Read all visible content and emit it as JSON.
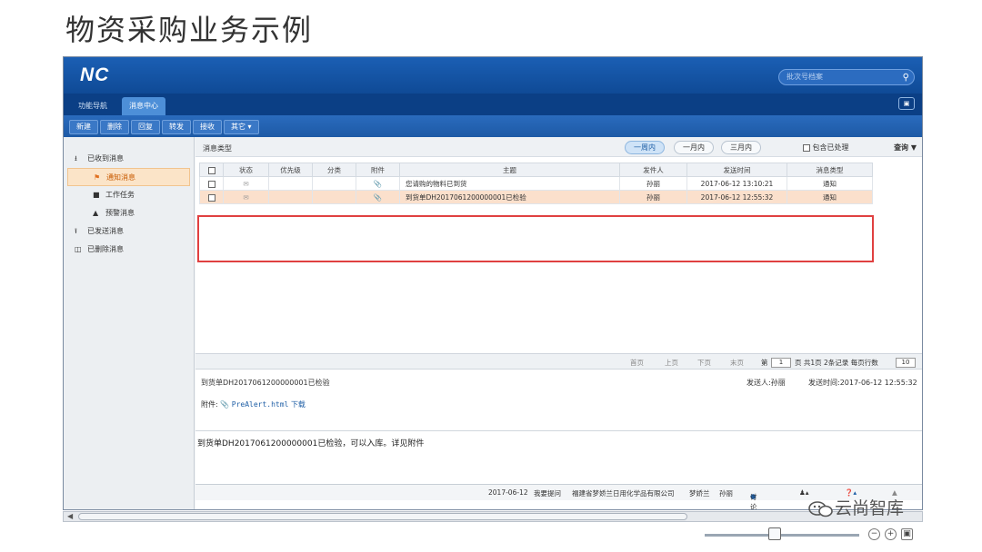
{
  "slide": {
    "title": "物资采购业务示例"
  },
  "header": {
    "logo": "NC",
    "search_placeholder": "批次号档案"
  },
  "tabs": [
    {
      "label": "功能导航"
    },
    {
      "label": "消息中心"
    }
  ],
  "toolbar": {
    "new": "新建",
    "delete": "删除",
    "reply": "回复",
    "forward": "转发",
    "receive": "接收",
    "other": "其它 ▾"
  },
  "sidebar": {
    "received": "已收到消息",
    "notice": "通知消息",
    "task": "工作任务",
    "alert": "预警消息",
    "sent": "已发送消息",
    "deleted": "已删除消息"
  },
  "filter": {
    "label": "消息类型",
    "week": "一周内",
    "month": "一月内",
    "three_months": "三月内",
    "include_processed": "包含已处理",
    "query": "查询"
  },
  "table": {
    "headers": [
      "状态",
      "优先级",
      "分类",
      "附件",
      "主题",
      "发件人",
      "发送时间",
      "消息类型"
    ],
    "rows": [
      {
        "subject": "您请购的物料已到货",
        "sender": "孙丽",
        "time": "2017-06-12 13:10:21",
        "type": "通知"
      },
      {
        "subject": "到货单DH2017061200000001已检验",
        "sender": "孙丽",
        "time": "2017-06-12 12:55:32",
        "type": "通知"
      }
    ]
  },
  "pager": {
    "first": "首页",
    "prev": "上页",
    "next": "下页",
    "last": "末页",
    "page_prefix": "第",
    "page_value": "1",
    "page_suffix": "页 共1页 2条记录 每页行数",
    "rows_per_page": "10"
  },
  "detail": {
    "subject": "到货单DH2017061200000001已检验",
    "sender": "发送人:孙丽",
    "send_time": "发送时间:2017-06-12 12:55:32",
    "attach_label": "附件:",
    "attach_file": "PreAlert.html",
    "download": "下载"
  },
  "body_text": "到货单DH2017061200000001已检验，可以入库。详见附件",
  "statusbar": {
    "date": "2017-06-12",
    "my_question": "我要提问",
    "company": "福建省梦娇兰日用化学品有限公司",
    "org": "梦娇兰",
    "user": "孙丽",
    "discuss": "讨论"
  },
  "watermark": "云尚智库",
  "colors": {
    "header_blue": "#1b5fb4",
    "selected_row": "#fbe0cc",
    "highlight_frame": "#e04040"
  }
}
